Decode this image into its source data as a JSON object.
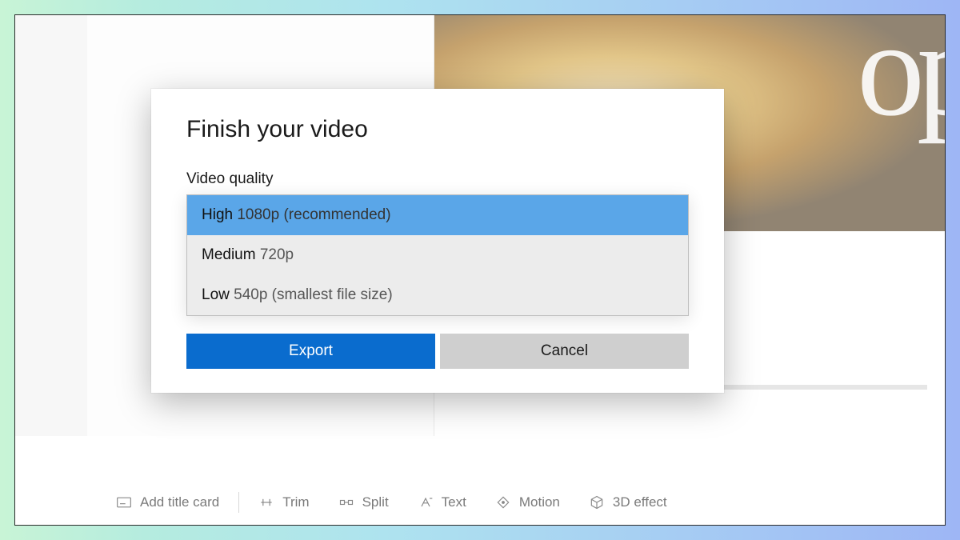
{
  "dialog": {
    "title": "Finish your video",
    "field_label": "Video quality",
    "options": [
      {
        "strong": "High",
        "sub": "1080p (recommended)",
        "selected": true
      },
      {
        "strong": "Medium",
        "sub": "720p",
        "selected": false
      },
      {
        "strong": "Low",
        "sub": "540p (smallest file size)",
        "selected": false
      }
    ],
    "export_label": "Export",
    "cancel_label": "Cancel"
  },
  "background": {
    "logo_fragment": "op"
  },
  "toolbar": {
    "items": [
      {
        "label": "Add title card",
        "icon": "title-card-icon"
      },
      {
        "label": "Trim",
        "icon": "trim-icon"
      },
      {
        "label": "Split",
        "icon": "split-icon"
      },
      {
        "label": "Text",
        "icon": "text-icon"
      },
      {
        "label": "Motion",
        "icon": "motion-icon"
      },
      {
        "label": "3D effect",
        "icon": "cube-icon"
      }
    ]
  }
}
